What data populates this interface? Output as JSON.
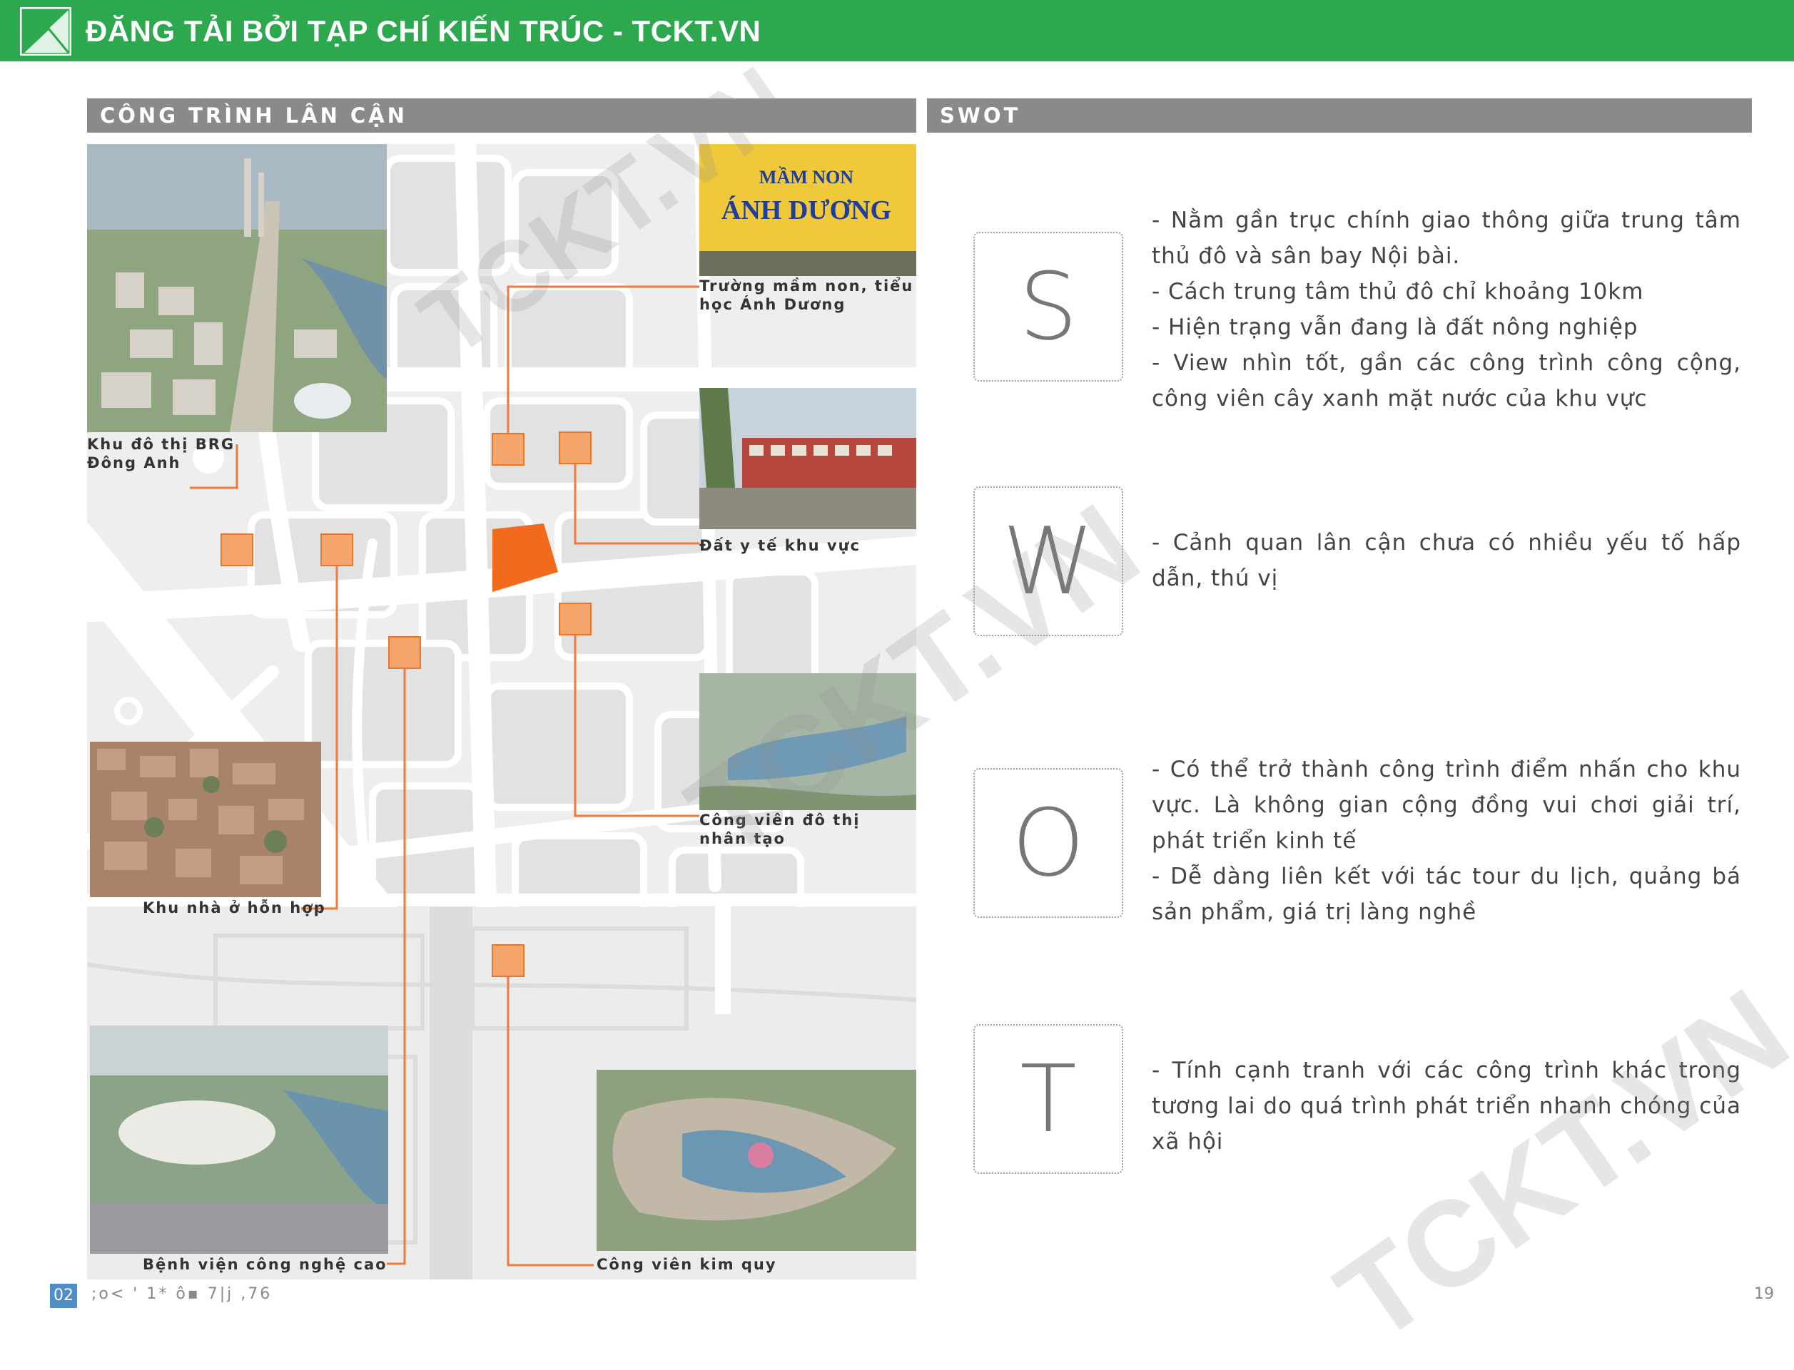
{
  "header": {
    "title": "ĐĂNG TẢI BỞI TẠP CHÍ KIẾN TRÚC - TCKT.VN",
    "color": "#2ea84f"
  },
  "left_section": {
    "title": "CÔNG TRÌNH LÂN CẬN"
  },
  "right_section": {
    "title": "SWOT"
  },
  "map": {
    "site_color": "#f26a1b",
    "marker_color": "#f5a66d",
    "labels": {
      "brg": "Khu đô thị BRG\nĐông Anh",
      "school": "Trường mầm non, tiểu\nhọc Ánh Dương",
      "health": "Đất y tế khu vực",
      "park_city": "Công viên đô thị\nnhân tạo",
      "housing": "Khu nhà ở hỗn hợp",
      "hospital": "Bệnh viện công nghệ cao",
      "park_kimquy": "Công viên kim quy"
    },
    "sign_text": {
      "line1": "MẦM NON",
      "line2": "ÁNH DƯƠNG"
    }
  },
  "swot": [
    {
      "letter": "S",
      "lines": [
        "- Nằm gần trục chính giao thông giữa trung tâm thủ đô và sân bay Nội bài.",
        "- Cách trung tâm thủ đô chỉ khoảng 10km",
        "- Hiện trạng vẫn đang là đất nông nghiệp",
        "- View nhìn tốt, gần các công trình công cộng, công viên cây xanh mặt nước của khu vực"
      ]
    },
    {
      "letter": "W",
      "lines": [
        "- Cảnh quan lân cận chưa có nhiều yếu tố hấp dẫn, thú vị"
      ]
    },
    {
      "letter": "O",
      "lines": [
        "- Có thể trở thành công trình điểm nhấn cho khu vực. Là không gian cộng đồng vui chơi giải trí, phát triển kinh tế",
        "- Dễ dàng liên kết với tác tour du lịch, quảng bá sản phẩm, giá trị làng nghề"
      ]
    },
    {
      "letter": "T",
      "lines": [
        "- Tính cạnh tranh với các công trình khác trong tương lai do quá trình phát triển nhanh chóng của xã hội"
      ]
    }
  ],
  "watermark": "TCKT.VN",
  "footer": {
    "page_box": "02",
    "code": ";o< ' 1* ô▪ 7|j ,76",
    "page_right": "19"
  }
}
